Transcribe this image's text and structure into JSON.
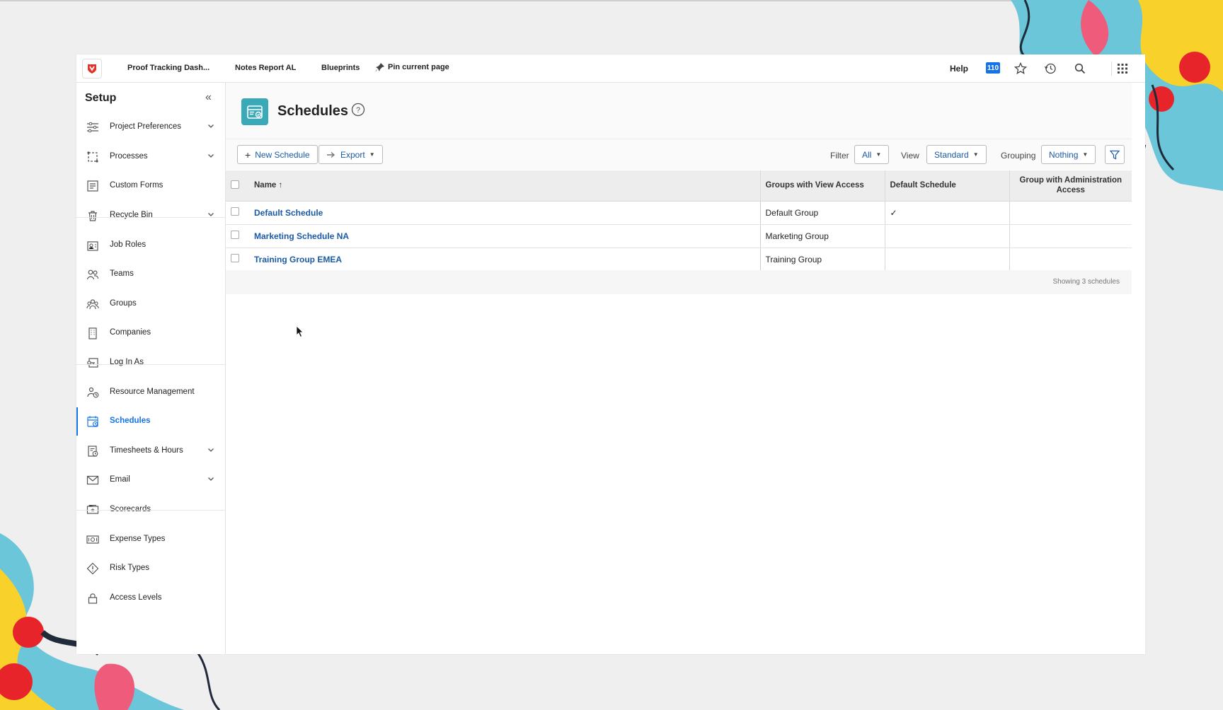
{
  "topnav": {
    "links": [
      "Proof Tracking Dash...",
      "Notes Report AL",
      "Blueprints",
      "Pin current page"
    ],
    "help": "Help",
    "notification_count": "110"
  },
  "sidebar": {
    "title": "Setup",
    "items": [
      {
        "label": "Project Preferences",
        "icon": "sliders-icon",
        "expandable": true
      },
      {
        "label": "Processes",
        "icon": "process-icon",
        "expandable": true
      },
      {
        "label": "Custom Forms",
        "icon": "form-icon",
        "expandable": false
      },
      {
        "label": "Recycle Bin",
        "icon": "trash-icon",
        "expandable": true
      },
      {
        "label": "Job Roles",
        "icon": "job-role-icon",
        "expandable": false
      },
      {
        "label": "Teams",
        "icon": "team-icon",
        "expandable": false
      },
      {
        "label": "Groups",
        "icon": "group-icon",
        "expandable": false
      },
      {
        "label": "Companies",
        "icon": "building-icon",
        "expandable": false
      },
      {
        "label": "Log In As",
        "icon": "login-icon",
        "expandable": false
      },
      {
        "label": "Resource Management",
        "icon": "resource-icon",
        "expandable": false
      },
      {
        "label": "Schedules",
        "icon": "calendar-icon",
        "expandable": false,
        "active": true
      },
      {
        "label": "Timesheets & Hours",
        "icon": "timesheet-icon",
        "expandable": true
      },
      {
        "label": "Email",
        "icon": "mail-icon",
        "expandable": true
      },
      {
        "label": "Scorecards",
        "icon": "scorecard-icon",
        "expandable": false
      },
      {
        "label": "Expense Types",
        "icon": "money-icon",
        "expandable": false
      },
      {
        "label": "Risk Types",
        "icon": "risk-icon",
        "expandable": false
      },
      {
        "label": "Access Levels",
        "icon": "lock-icon",
        "expandable": false
      }
    ]
  },
  "page": {
    "title": "Schedules"
  },
  "toolbar": {
    "new_label": "New Schedule",
    "export_label": "Export",
    "filter_label": "Filter",
    "filter_value": "All",
    "view_label": "View",
    "view_value": "Standard",
    "grouping_label": "Grouping",
    "grouping_value": "Nothing"
  },
  "table": {
    "columns": [
      "Name ↑",
      "Groups with View Access",
      "Default Schedule",
      "Group with Administration Access"
    ],
    "rows": [
      {
        "name": "Default Schedule",
        "groups": "Default Group",
        "default": "✓",
        "admin": ""
      },
      {
        "name": "Marketing Schedule NA",
        "groups": "Marketing Group",
        "default": "",
        "admin": ""
      },
      {
        "name": "Training Group EMEA",
        "groups": "Training Group",
        "default": "",
        "admin": ""
      }
    ],
    "footer": "Showing 3 schedules"
  },
  "colors": {
    "accent": "#1473e6",
    "link": "#1a5aa6",
    "page_icon": "#3aa9b8"
  }
}
